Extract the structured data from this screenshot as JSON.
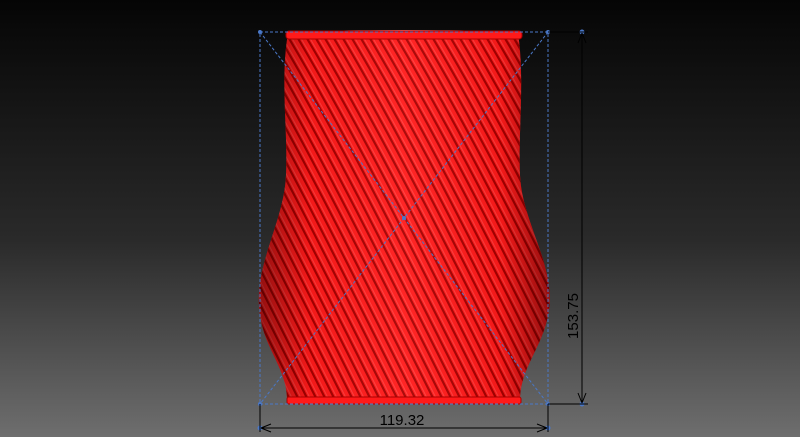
{
  "viewport": {
    "model_color": "#ff1a1a",
    "rib_color": "#a80000",
    "highlight_color": "#ff8080",
    "bbox_color": "#4a78c8",
    "dimension_color": "#000000"
  },
  "dimensions": {
    "width_value": "119.32",
    "height_value": "153.75"
  }
}
